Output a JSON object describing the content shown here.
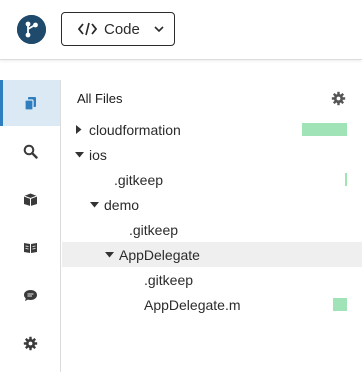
{
  "header": {
    "code_button_label": "Code"
  },
  "sidebar": {
    "items": [
      {
        "name": "files",
        "active": true
      },
      {
        "name": "search",
        "active": false
      },
      {
        "name": "packages",
        "active": false
      },
      {
        "name": "docs",
        "active": false
      },
      {
        "name": "chat",
        "active": false
      },
      {
        "name": "settings",
        "active": false
      }
    ]
  },
  "panel": {
    "title": "All Files"
  },
  "tree": [
    {
      "label": "cloudformation",
      "depth": 0,
      "type": "folder",
      "expanded": false,
      "selected": false,
      "change_fraction": 1.0
    },
    {
      "label": "ios",
      "depth": 0,
      "type": "folder",
      "expanded": true,
      "selected": false,
      "change_fraction": 0
    },
    {
      "label": ".gitkeep",
      "depth": 1,
      "type": "file",
      "selected": false,
      "change_fraction": 0.05
    },
    {
      "label": "demo",
      "depth": 1,
      "type": "folder",
      "expanded": true,
      "selected": false,
      "change_fraction": 0
    },
    {
      "label": ".gitkeep",
      "depth": 2,
      "type": "file",
      "selected": false,
      "change_fraction": 0
    },
    {
      "label": "AppDelegate",
      "depth": 2,
      "type": "folder",
      "expanded": true,
      "selected": true,
      "change_fraction": 0
    },
    {
      "label": ".gitkeep",
      "depth": 3,
      "type": "file",
      "selected": false,
      "change_fraction": 0
    },
    {
      "label": "AppDelegate.m",
      "depth": 3,
      "type": "file",
      "selected": false,
      "change_fraction": 0.3
    }
  ],
  "colors": {
    "accent": "#2f7ec0",
    "logo": "#1f4a6b",
    "active_bg": "#dbe9f4",
    "selected_row": "#efefef",
    "change_bar": "#9fe3b6"
  }
}
